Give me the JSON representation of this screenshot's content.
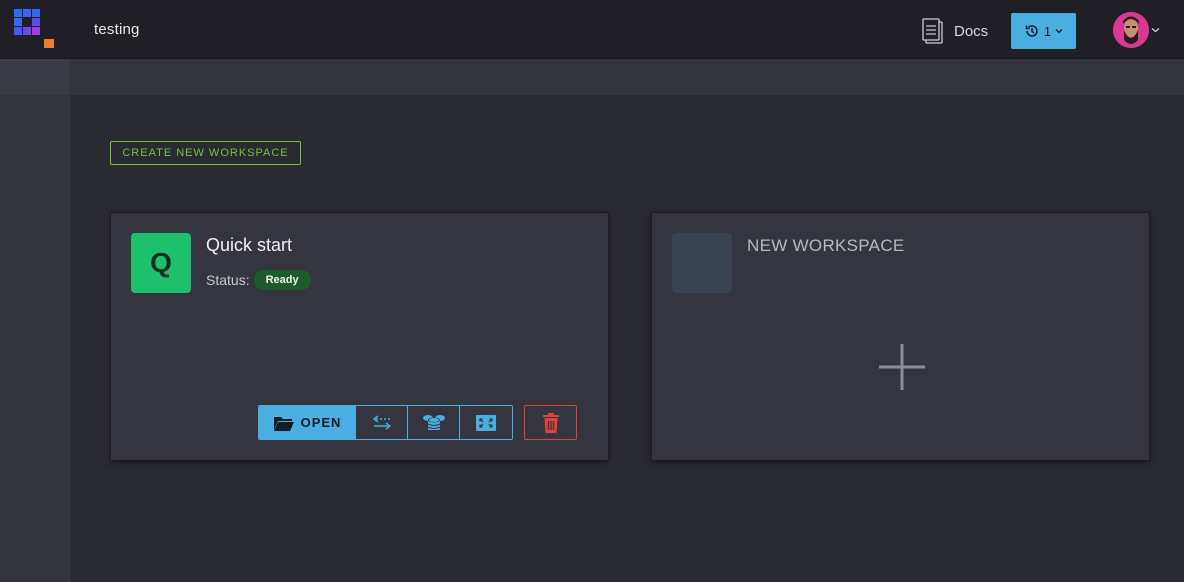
{
  "header": {
    "app_title": "testing",
    "docs_label": "Docs",
    "history_count": "1",
    "logo_icon": "app-logo-grid-icon"
  },
  "main": {
    "create_button": "CREATE NEW WORKSPACE",
    "workspace": {
      "avatar_letter": "Q",
      "name": "Quick start",
      "status_label": "Status:",
      "status_value": "Ready",
      "open_label": "OPEN",
      "actions": [
        "ports-icon",
        "database-icon",
        "resize-icon"
      ]
    },
    "new_workspace": {
      "title": "NEW WORKSPACE"
    }
  },
  "colors": {
    "accent_blue": "#4aaee1",
    "accent_green": "#7ac142",
    "ready_badge": "#1f5a2a",
    "danger": "#e0433f",
    "workspace_avatar": "#1ec06b"
  }
}
